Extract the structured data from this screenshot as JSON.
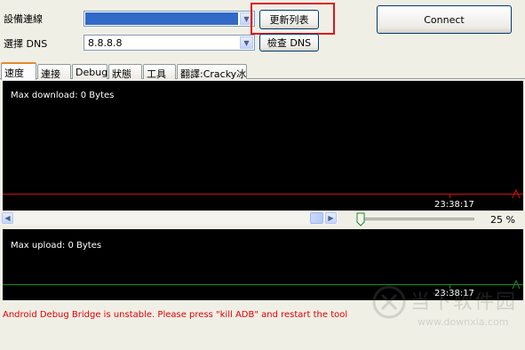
{
  "device_row": {
    "label": "設備連線",
    "refresh_button": "更新列表"
  },
  "dns_row": {
    "label": "選擇 DNS",
    "value": "8.8.8.8",
    "check_button": "檢查 DNS"
  },
  "connect_button": "Connect",
  "tabs": [
    {
      "label": "速度",
      "active": true
    },
    {
      "label": "連接"
    },
    {
      "label": "Debug"
    },
    {
      "label": "狀態"
    },
    {
      "label": "工具"
    },
    {
      "label": "翻譯:Cracky冰"
    }
  ],
  "download_graph": {
    "title": "Max download: 0 Bytes",
    "time": "23:38:17"
  },
  "zoom": {
    "percent": "25 %"
  },
  "upload_graph": {
    "title": "Max upload: 0 Bytes",
    "time": "23:38:17"
  },
  "status_message": "Android Debug Bridge is unstable. Please press \"kill ADB\" and restart the tool",
  "watermark": {
    "text": "当下软件园",
    "url": "www.downxia.com"
  },
  "colors": {
    "highlight": "#e0141b",
    "error_text": "#e00000",
    "selection": "#3169c6"
  }
}
